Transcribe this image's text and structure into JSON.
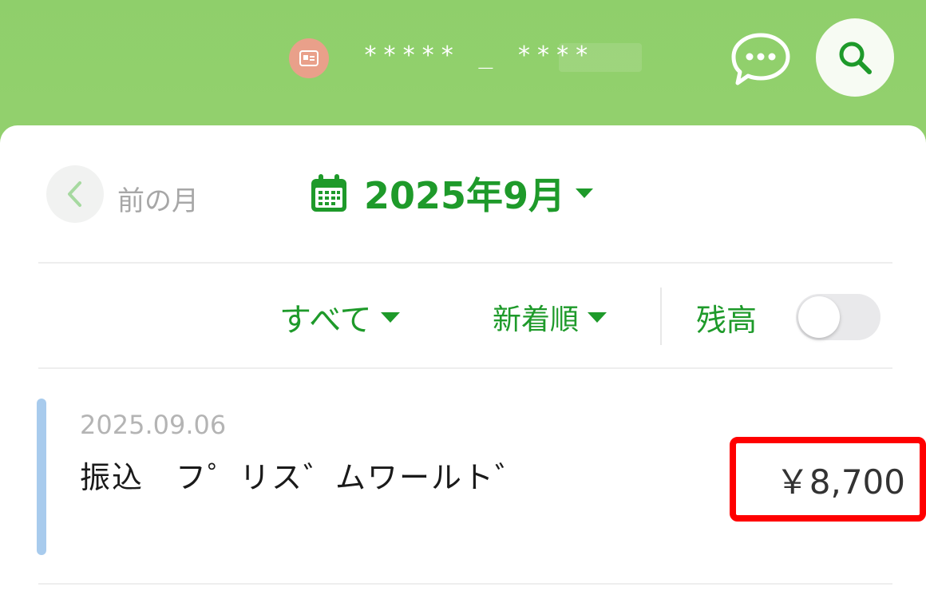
{
  "header": {
    "account_masked": "***** _ ****",
    "icons": {
      "account": "card-icon",
      "chat": "chat-bubble-icon",
      "search": "search-icon"
    }
  },
  "nav": {
    "prev_label": "前の月",
    "month_label": "2025年9月",
    "icons": {
      "prev": "chevron-left-icon",
      "calendar": "calendar-icon",
      "caret": "caret-down-icon"
    }
  },
  "filters": {
    "all_label": "すべて",
    "sort_label": "新着順",
    "balance_label": "残高",
    "balance_toggle_on": false
  },
  "transactions": [
    {
      "date": "2025.09.06",
      "description": "振込　フ゜リス゛ムワールト゛",
      "amount": "￥8,700"
    }
  ],
  "colors": {
    "header_green": "#9fd576",
    "brand_green": "#1e9a2a",
    "account_icon_bg": "#e9a08a",
    "tx_bar": "#a8cbed",
    "highlight_red": "#ff0000"
  }
}
